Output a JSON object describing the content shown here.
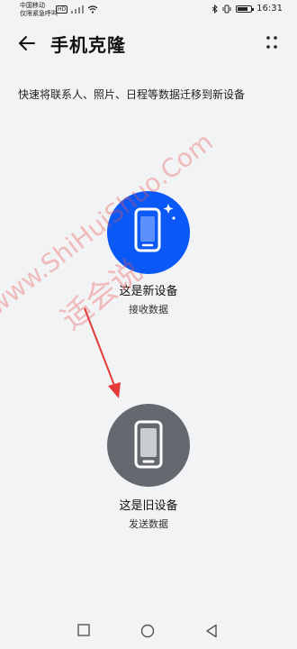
{
  "status_bar": {
    "carrier_line1": "中国移动",
    "carrier_line2": "仅限紧急呼叫",
    "hd_badge": "HD",
    "time": "16:31"
  },
  "header": {
    "title": "手机克隆"
  },
  "subtitle": "快速将联系人、照片、日程等数据迁移到新设备",
  "new_device": {
    "label": "这是新设备",
    "sub": "接收数据"
  },
  "old_device": {
    "label": "这是旧设备",
    "sub": "发送数据"
  },
  "watermark": {
    "cn": "适会说",
    "en": "www.ShiHuiShuo.Com"
  },
  "colors": {
    "new_circle": "#0a59f7",
    "old_circle": "#646970",
    "background": "#f1f3f5",
    "arrow": "#e53935"
  }
}
